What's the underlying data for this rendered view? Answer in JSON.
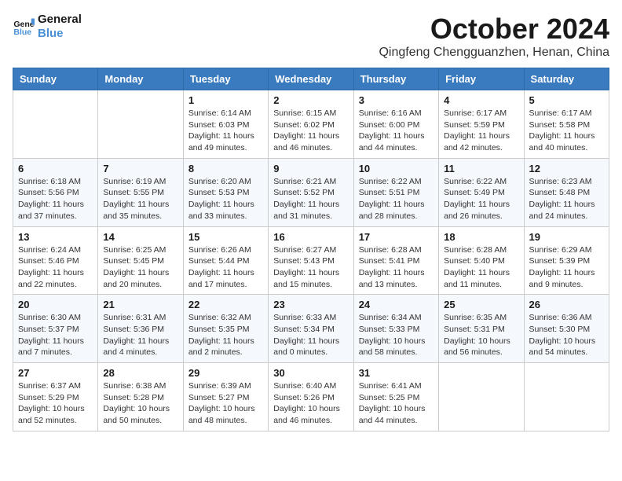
{
  "header": {
    "logo_line1": "General",
    "logo_line2": "Blue",
    "month": "October 2024",
    "location": "Qingfeng Chengguanzhen, Henan, China"
  },
  "days_of_week": [
    "Sunday",
    "Monday",
    "Tuesday",
    "Wednesday",
    "Thursday",
    "Friday",
    "Saturday"
  ],
  "weeks": [
    [
      {
        "day": "",
        "info": ""
      },
      {
        "day": "",
        "info": ""
      },
      {
        "day": "1",
        "info": "Sunrise: 6:14 AM\nSunset: 6:03 PM\nDaylight: 11 hours and 49 minutes."
      },
      {
        "day": "2",
        "info": "Sunrise: 6:15 AM\nSunset: 6:02 PM\nDaylight: 11 hours and 46 minutes."
      },
      {
        "day": "3",
        "info": "Sunrise: 6:16 AM\nSunset: 6:00 PM\nDaylight: 11 hours and 44 minutes."
      },
      {
        "day": "4",
        "info": "Sunrise: 6:17 AM\nSunset: 5:59 PM\nDaylight: 11 hours and 42 minutes."
      },
      {
        "day": "5",
        "info": "Sunrise: 6:17 AM\nSunset: 5:58 PM\nDaylight: 11 hours and 40 minutes."
      }
    ],
    [
      {
        "day": "6",
        "info": "Sunrise: 6:18 AM\nSunset: 5:56 PM\nDaylight: 11 hours and 37 minutes."
      },
      {
        "day": "7",
        "info": "Sunrise: 6:19 AM\nSunset: 5:55 PM\nDaylight: 11 hours and 35 minutes."
      },
      {
        "day": "8",
        "info": "Sunrise: 6:20 AM\nSunset: 5:53 PM\nDaylight: 11 hours and 33 minutes."
      },
      {
        "day": "9",
        "info": "Sunrise: 6:21 AM\nSunset: 5:52 PM\nDaylight: 11 hours and 31 minutes."
      },
      {
        "day": "10",
        "info": "Sunrise: 6:22 AM\nSunset: 5:51 PM\nDaylight: 11 hours and 28 minutes."
      },
      {
        "day": "11",
        "info": "Sunrise: 6:22 AM\nSunset: 5:49 PM\nDaylight: 11 hours and 26 minutes."
      },
      {
        "day": "12",
        "info": "Sunrise: 6:23 AM\nSunset: 5:48 PM\nDaylight: 11 hours and 24 minutes."
      }
    ],
    [
      {
        "day": "13",
        "info": "Sunrise: 6:24 AM\nSunset: 5:46 PM\nDaylight: 11 hours and 22 minutes."
      },
      {
        "day": "14",
        "info": "Sunrise: 6:25 AM\nSunset: 5:45 PM\nDaylight: 11 hours and 20 minutes."
      },
      {
        "day": "15",
        "info": "Sunrise: 6:26 AM\nSunset: 5:44 PM\nDaylight: 11 hours and 17 minutes."
      },
      {
        "day": "16",
        "info": "Sunrise: 6:27 AM\nSunset: 5:43 PM\nDaylight: 11 hours and 15 minutes."
      },
      {
        "day": "17",
        "info": "Sunrise: 6:28 AM\nSunset: 5:41 PM\nDaylight: 11 hours and 13 minutes."
      },
      {
        "day": "18",
        "info": "Sunrise: 6:28 AM\nSunset: 5:40 PM\nDaylight: 11 hours and 11 minutes."
      },
      {
        "day": "19",
        "info": "Sunrise: 6:29 AM\nSunset: 5:39 PM\nDaylight: 11 hours and 9 minutes."
      }
    ],
    [
      {
        "day": "20",
        "info": "Sunrise: 6:30 AM\nSunset: 5:37 PM\nDaylight: 11 hours and 7 minutes."
      },
      {
        "day": "21",
        "info": "Sunrise: 6:31 AM\nSunset: 5:36 PM\nDaylight: 11 hours and 4 minutes."
      },
      {
        "day": "22",
        "info": "Sunrise: 6:32 AM\nSunset: 5:35 PM\nDaylight: 11 hours and 2 minutes."
      },
      {
        "day": "23",
        "info": "Sunrise: 6:33 AM\nSunset: 5:34 PM\nDaylight: 11 hours and 0 minutes."
      },
      {
        "day": "24",
        "info": "Sunrise: 6:34 AM\nSunset: 5:33 PM\nDaylight: 10 hours and 58 minutes."
      },
      {
        "day": "25",
        "info": "Sunrise: 6:35 AM\nSunset: 5:31 PM\nDaylight: 10 hours and 56 minutes."
      },
      {
        "day": "26",
        "info": "Sunrise: 6:36 AM\nSunset: 5:30 PM\nDaylight: 10 hours and 54 minutes."
      }
    ],
    [
      {
        "day": "27",
        "info": "Sunrise: 6:37 AM\nSunset: 5:29 PM\nDaylight: 10 hours and 52 minutes."
      },
      {
        "day": "28",
        "info": "Sunrise: 6:38 AM\nSunset: 5:28 PM\nDaylight: 10 hours and 50 minutes."
      },
      {
        "day": "29",
        "info": "Sunrise: 6:39 AM\nSunset: 5:27 PM\nDaylight: 10 hours and 48 minutes."
      },
      {
        "day": "30",
        "info": "Sunrise: 6:40 AM\nSunset: 5:26 PM\nDaylight: 10 hours and 46 minutes."
      },
      {
        "day": "31",
        "info": "Sunrise: 6:41 AM\nSunset: 5:25 PM\nDaylight: 10 hours and 44 minutes."
      },
      {
        "day": "",
        "info": ""
      },
      {
        "day": "",
        "info": ""
      }
    ]
  ]
}
